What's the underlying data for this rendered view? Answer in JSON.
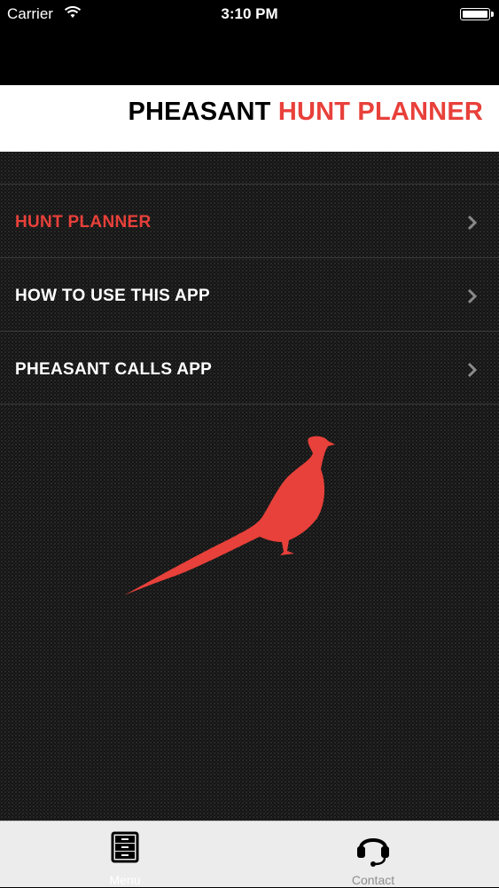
{
  "status_bar": {
    "carrier": "Carrier",
    "time": "3:10 PM"
  },
  "header": {
    "title_part1": "PHEASANT",
    "title_part2": "HUNT PLANNER"
  },
  "menu": {
    "items": [
      {
        "label": "HUNT PLANNER",
        "active": true
      },
      {
        "label": "HOW TO USE THIS APP",
        "active": false
      },
      {
        "label": "PHEASANT CALLS APP",
        "active": false
      }
    ]
  },
  "tabbar": {
    "tabs": [
      {
        "label": "Menu",
        "icon": "file-cabinet-icon",
        "active": true
      },
      {
        "label": "Contact",
        "icon": "headset-icon",
        "active": false
      }
    ]
  },
  "colors": {
    "accent": "#e8403a",
    "header_bg": "#ffffff",
    "content_bg": "#141414",
    "tabbar_bg": "#ececec"
  }
}
